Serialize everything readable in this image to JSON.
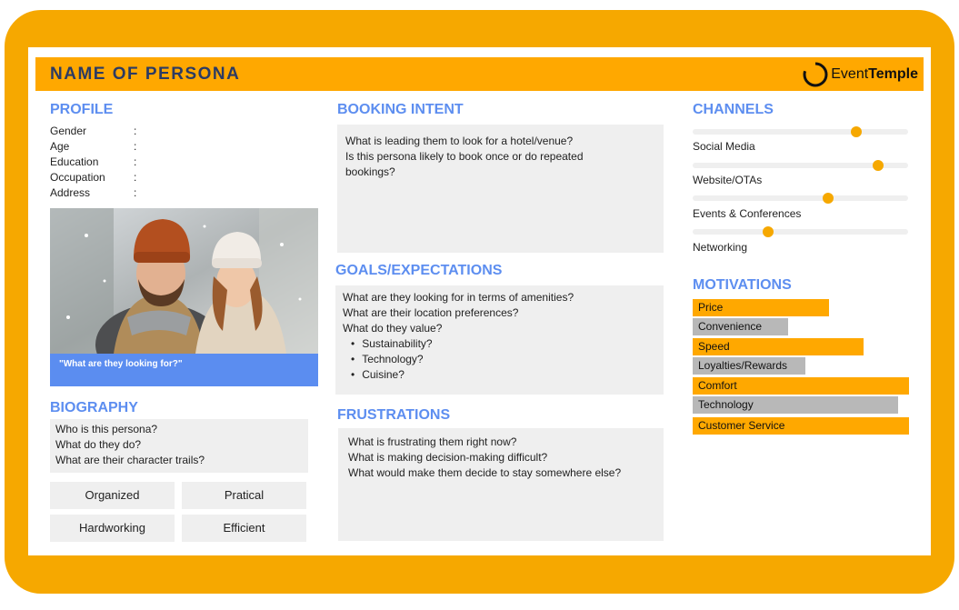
{
  "header": {
    "title": "NAME OF PERSONA",
    "logo_light": "Event",
    "logo_bold": "Temple"
  },
  "profile": {
    "heading": "PROFILE",
    "fields": [
      "Gender",
      "Age",
      "Education",
      "Occupation",
      "Address"
    ],
    "colon": ":",
    "caption": "\"What are they looking for?\""
  },
  "biography": {
    "heading": "BIOGRAPHY",
    "lines": [
      "Who is this persona?",
      "What do they do?",
      "What are their character trails?"
    ],
    "traits": [
      "Organized",
      "Pratical",
      "Hardworking",
      "Efficient"
    ]
  },
  "booking_intent": {
    "heading": "BOOKING INTENT",
    "lines": [
      "What is leading them to look for a hotel/venue?",
      "Is this persona likely to book once or do repeated",
      "bookings?"
    ]
  },
  "goals": {
    "heading": "GOALS/EXPECTATIONS",
    "lines": [
      "What are they looking for in terms of amenities?",
      "What are their location preferences?",
      "What do they value?"
    ],
    "bullets": [
      "Sustainability?",
      "Technology?",
      "Cuisine?"
    ]
  },
  "frustrations": {
    "heading": "FRUSTRATIONS",
    "lines": [
      "What is frustrating them right now?",
      "What is making decision-making difficult?",
      "What would make them decide to stay somewhere else?"
    ]
  },
  "channels": {
    "heading": "CHANNELS",
    "items": [
      {
        "label": "Social Media",
        "level": 0.76
      },
      {
        "label": "Website/OTAs",
        "level": 0.86
      },
      {
        "label": "Events & Conferences",
        "level": 0.63
      },
      {
        "label": "Networking",
        "level": 0.35
      }
    ]
  },
  "motivations": {
    "heading": "MOTIVATIONS",
    "items": [
      {
        "label": "Price",
        "level": 0.63,
        "color": "#ffa800"
      },
      {
        "label": "Convenience",
        "level": 0.44,
        "color": "#b8b8b8"
      },
      {
        "label": "Speed",
        "level": 0.79,
        "color": "#ffa800"
      },
      {
        "label": "Loyalties/Rewards",
        "level": 0.52,
        "color": "#b8b8b8"
      },
      {
        "label": "Comfort",
        "level": 1.0,
        "color": "#ffa800"
      },
      {
        "label": "Technology",
        "level": 0.95,
        "color": "#b8b8b8"
      },
      {
        "label": "Customer Service",
        "level": 1.0,
        "color": "#ffa800"
      }
    ]
  }
}
